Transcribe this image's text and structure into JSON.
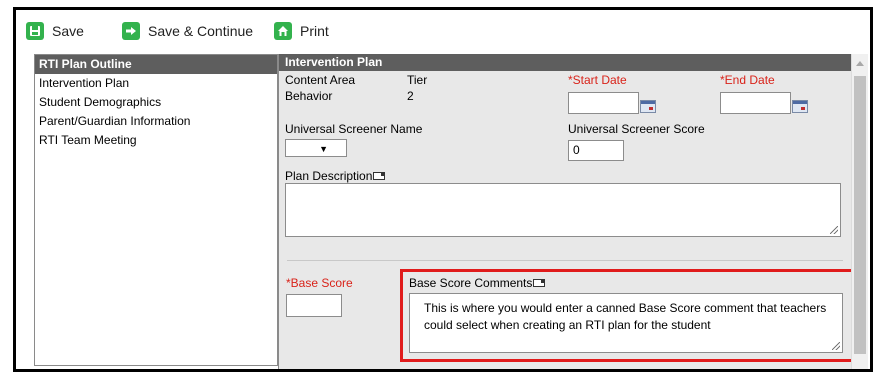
{
  "toolbar": {
    "save_label": "Save",
    "save_continue_label": "Save & Continue",
    "print_label": "Print"
  },
  "outline": {
    "title": "RTI Plan Outline",
    "items": [
      {
        "label": "Intervention Plan"
      },
      {
        "label": "Student Demographics"
      },
      {
        "label": "Parent/Guardian Information"
      },
      {
        "label": "RTI Team Meeting"
      }
    ]
  },
  "plan": {
    "title": "Intervention Plan",
    "content_area_label": "Content Area",
    "content_area_value": "Behavior",
    "tier_label": "Tier",
    "tier_value": "2",
    "start_date_label": "*Start Date",
    "start_date_value": "",
    "end_date_label": "*End Date",
    "end_date_value": "",
    "screener_name_label": "Universal Screener Name",
    "screener_name_value": "",
    "screener_score_label": "Universal Screener Score",
    "screener_score_value": "0",
    "plan_description_label": "Plan Description",
    "plan_description_value": "",
    "base_score_label": "*Base Score",
    "base_score_value": "",
    "base_score_comments_label": "Base Score Comments",
    "base_score_comments_value": "This is where you would enter a canned Base Score comment that teachers could select when creating an RTI plan for the student"
  },
  "colors": {
    "header_bg": "#5e5e5e",
    "panel_bg": "#e8e8e8",
    "required_text": "#d9231a",
    "highlight_border": "#e01b1b",
    "toolbar_icon": "#33b24d"
  }
}
